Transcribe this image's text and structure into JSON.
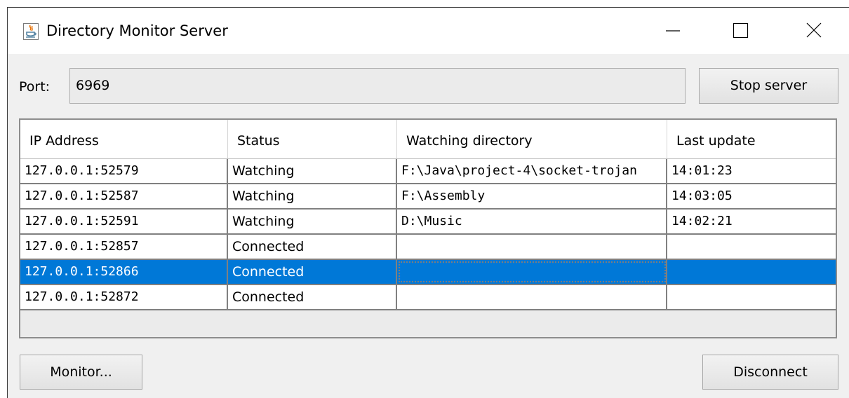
{
  "window": {
    "title": "Directory Monitor Server",
    "icon": "java-coffee-icon",
    "controls": [
      "minimize-icon",
      "maximize-icon",
      "close-icon"
    ]
  },
  "port": {
    "label": "Port:",
    "value": "6969"
  },
  "buttons": {
    "stop_server": "Stop server",
    "monitor": "Monitor...",
    "disconnect": "Disconnect"
  },
  "table": {
    "columns": [
      "IP Address",
      "Status",
      "Watching directory",
      "Last update"
    ],
    "rows": [
      {
        "ip": "127.0.0.1:52579",
        "status": "Watching",
        "directory": "F:\\Java\\project-4\\socket-trojan",
        "last_update": "14:01:23",
        "selected": false
      },
      {
        "ip": "127.0.0.1:52587",
        "status": "Watching",
        "directory": "F:\\Assembly",
        "last_update": "14:03:05",
        "selected": false
      },
      {
        "ip": "127.0.0.1:52591",
        "status": "Watching",
        "directory": "D:\\Music",
        "last_update": "14:02:21",
        "selected": false
      },
      {
        "ip": "127.0.0.1:52857",
        "status": "Connected",
        "directory": "",
        "last_update": "",
        "selected": false
      },
      {
        "ip": "127.0.0.1:52866",
        "status": "Connected",
        "directory": "",
        "last_update": "",
        "selected": true
      },
      {
        "ip": "127.0.0.1:52872",
        "status": "Connected",
        "directory": "",
        "last_update": "",
        "selected": false
      }
    ]
  },
  "colors": {
    "selection": "#0078d7",
    "window_background": "#f0f0f0",
    "grid_lines": "#808080"
  }
}
